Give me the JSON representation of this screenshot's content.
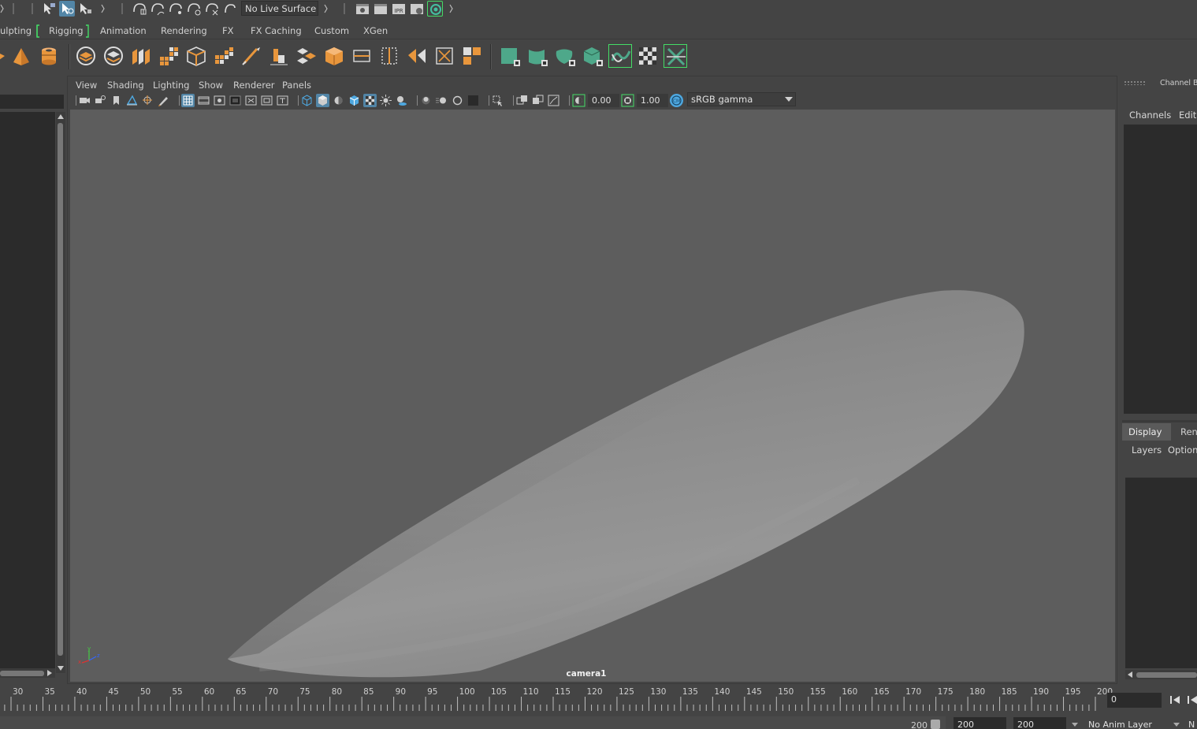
{
  "status_line": {
    "live_surface_label": "No Live Surface",
    "icons": [
      "select-by-hierarchy-icon",
      "select-by-object-icon",
      "select-by-component-icon",
      "snap-to-grid-icon",
      "snap-to-curve-icon",
      "snap-to-point-icon",
      "snap-to-view-plane-icon",
      "make-live-icon",
      "render-frame-icon",
      "render-sequence-icon",
      "ipr-render-icon",
      "render-settings-icon",
      "hypershade-icon"
    ]
  },
  "shelf_tabs": [
    "ulpting",
    "Rigging",
    "Animation",
    "Rendering",
    "FX",
    "FX Caching",
    "Custom",
    "XGen"
  ],
  "shelf_icons": [
    "pyramid-icon",
    "pipe-icon",
    "bevel-icon",
    "bridge-icon",
    "extrude-icon",
    "fill-hole-icon",
    "multi-cut-icon",
    "append-polygon-icon",
    "target-weld-icon",
    "edge-loop-icon",
    "combine-icon",
    "separate-icon",
    "uv-layout-icon",
    "bounding-box-icon",
    "mirror-icon",
    "smooth-icon",
    "unfold-icon",
    "extract-icon",
    "planar-uv-icon",
    "cylindrical-uv-icon",
    "spherical-uv-icon",
    "automatic-uv-icon",
    "uv-editor-icon",
    "checker-icon",
    "cut-uv-icon"
  ],
  "viewport": {
    "menu": [
      "View",
      "Shading",
      "Lighting",
      "Show",
      "Renderer",
      "Panels"
    ],
    "exposure": "0.00",
    "gamma": "1.00",
    "colorspace": "sRGB gamma",
    "camera": "camera1",
    "axis": {
      "x": "x",
      "y": "y",
      "z": "z"
    }
  },
  "channel_box": {
    "title": "Channel Box",
    "menu": [
      "Channels",
      "Edit"
    ],
    "layer_tabs": [
      "Display",
      "Ren"
    ],
    "layer_menu": [
      "Layers",
      "Option"
    ]
  },
  "time_slider": {
    "ticks": [
      "30",
      "35",
      "40",
      "45",
      "50",
      "55",
      "60",
      "65",
      "70",
      "75",
      "80",
      "85",
      "90",
      "95",
      "100",
      "105",
      "110",
      "115",
      "120",
      "125",
      "130",
      "135",
      "140",
      "145",
      "150",
      "155",
      "160",
      "165",
      "170",
      "175",
      "180",
      "185",
      "190",
      "195",
      "200"
    ],
    "current_frame": "0"
  },
  "range_slider": {
    "end_value": "200",
    "playback_end": "200",
    "animation_end": "200",
    "anim_layer": "No Anim Layer",
    "char_set": "N"
  },
  "colors": {
    "ui_bg": "#444444",
    "viewport_bg": "#5d5d5d",
    "accent_green": "#44dd66",
    "shelf_orange": "#e8963c",
    "shelf_teal": "#4ea88a",
    "active_blue": "#5285a6"
  }
}
